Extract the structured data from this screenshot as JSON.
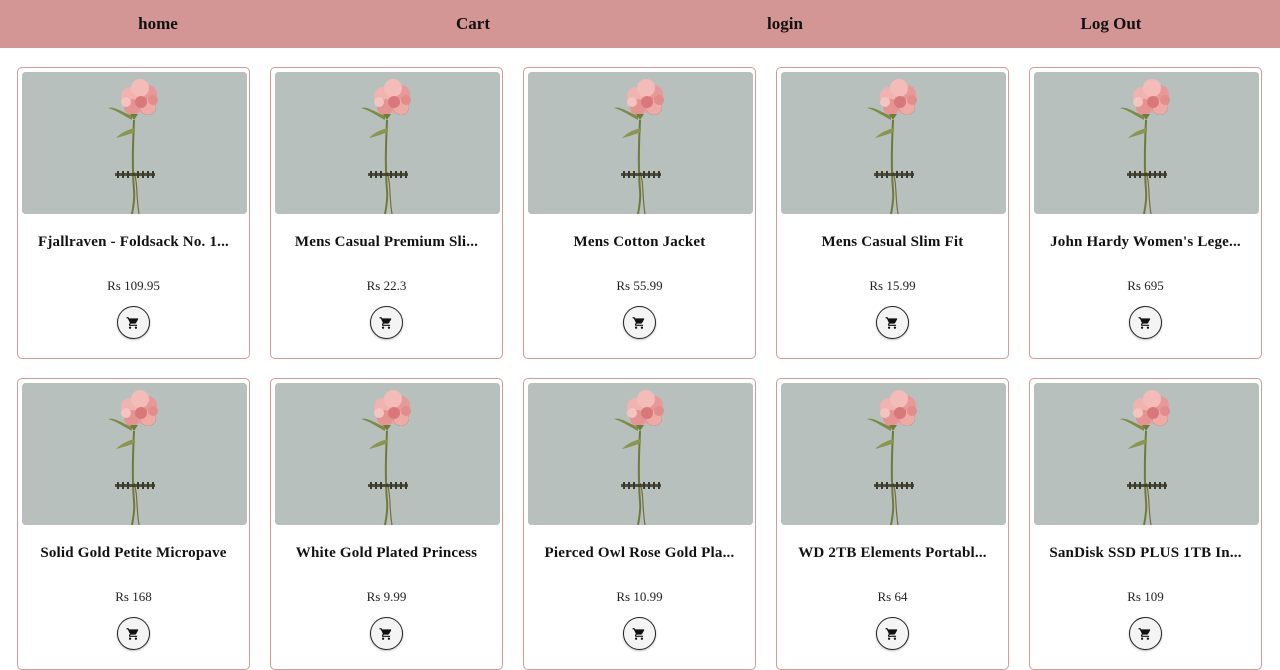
{
  "nav": {
    "home": "home",
    "cart": "Cart",
    "login": "login",
    "logout": "Log Out"
  },
  "products": [
    {
      "title": "Fjallraven - Foldsack No. 1...",
      "price": "Rs 109.95",
      "image": "pink-carnation-flower-photo"
    },
    {
      "title": "Mens Casual Premium Sli...",
      "price": "Rs 22.3",
      "image": "pink-carnation-flower-photo"
    },
    {
      "title": "Mens Cotton Jacket",
      "price": "Rs 55.99",
      "image": "pink-carnation-flower-photo"
    },
    {
      "title": "Mens Casual Slim Fit",
      "price": "Rs 15.99",
      "image": "pink-carnation-flower-photo"
    },
    {
      "title": "John Hardy Women's Lege...",
      "price": "Rs 695",
      "image": "pink-carnation-flower-photo"
    },
    {
      "title": "Solid Gold Petite Micropave",
      "price": "Rs 168",
      "image": "pink-carnation-flower-photo"
    },
    {
      "title": "White Gold Plated Princess",
      "price": "Rs 9.99",
      "image": "pink-carnation-flower-photo"
    },
    {
      "title": "Pierced Owl Rose Gold Pla...",
      "price": "Rs 10.99",
      "image": "pink-carnation-flower-photo"
    },
    {
      "title": "WD 2TB Elements Portabl...",
      "price": "Rs 64",
      "image": "pink-carnation-flower-photo"
    },
    {
      "title": "SanDisk SSD PLUS 1TB In...",
      "price": "Rs 109",
      "image": "pink-carnation-flower-photo"
    }
  ],
  "icons": {
    "cart_button": "shopping-cart-icon"
  },
  "colors": {
    "navbar": "#d49595",
    "card_border": "#d49a9a"
  }
}
